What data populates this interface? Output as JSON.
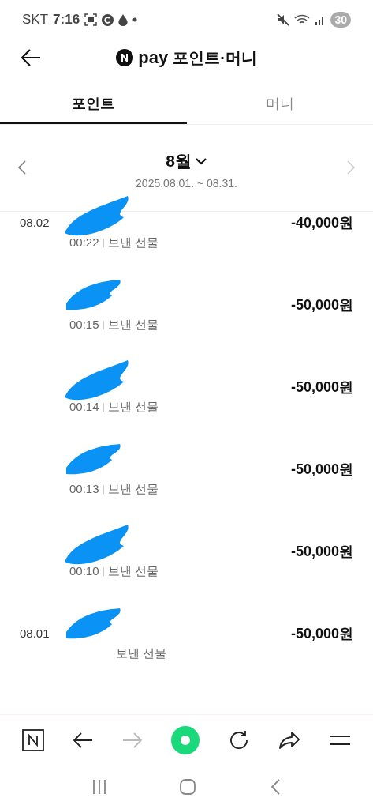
{
  "status_bar": {
    "carrier": "SKT",
    "time": "7:16",
    "battery": "30"
  },
  "header": {
    "brand": "pay",
    "title": "포인트·머니"
  },
  "tabs": [
    {
      "label": "포인트",
      "selected": true
    },
    {
      "label": "머니",
      "selected": false
    }
  ],
  "period": {
    "month": "8월",
    "range": "2025.08.01. ~ 08.31."
  },
  "transactions": [
    {
      "date": "08.02",
      "time": "00:22",
      "type": "보낸 선물",
      "amount": "-40,000원"
    },
    {
      "time": "00:15",
      "type": "보낸 선물",
      "amount": "-50,000원"
    },
    {
      "time": "00:14",
      "type": "보낸 선물",
      "amount": "-50,000원"
    },
    {
      "time": "00:13",
      "type": "보낸 선물",
      "amount": "-50,000원"
    },
    {
      "time": "00:10",
      "type": "보낸 선물",
      "amount": "-50,000원"
    },
    {
      "date": "08.01",
      "type": "보낸 선물",
      "amount": "-50,000원"
    }
  ]
}
